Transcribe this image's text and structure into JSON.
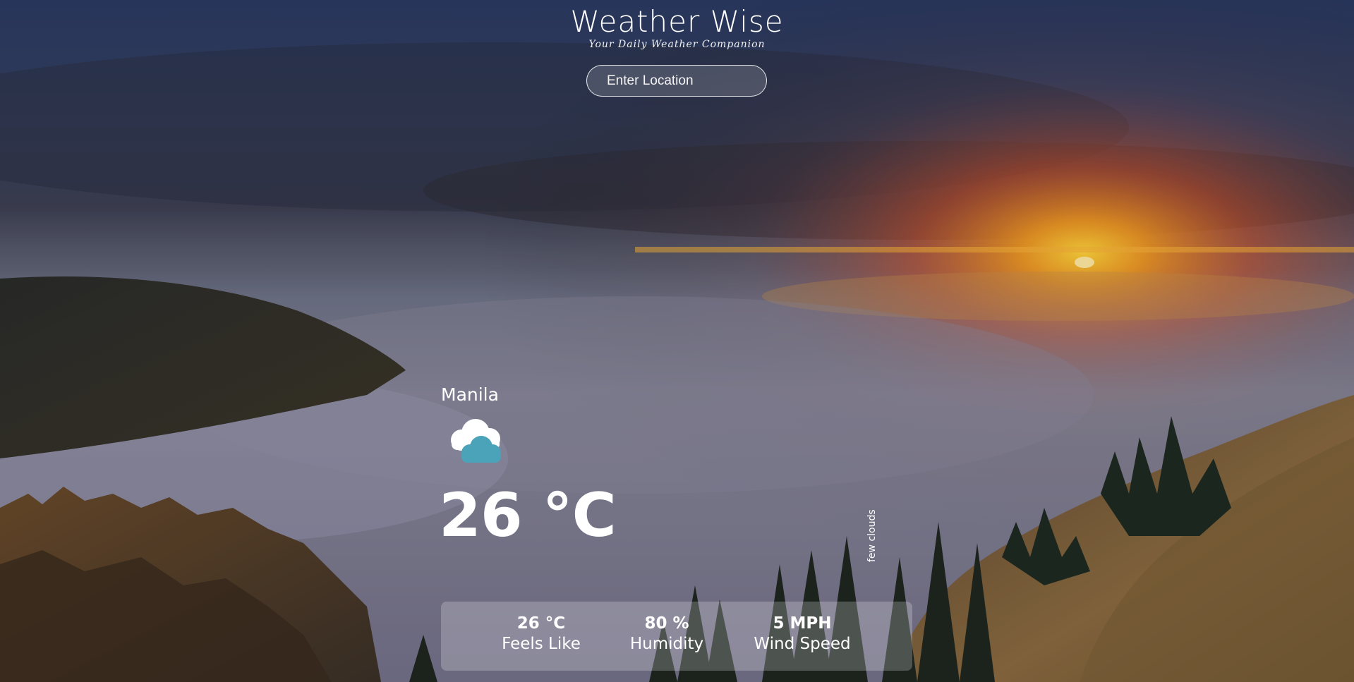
{
  "header": {
    "title": "Weather Wise",
    "subtitle": "Your Daily Weather Companion"
  },
  "search": {
    "placeholder": "Enter Location",
    "value": ""
  },
  "weather": {
    "city": "Manila",
    "icon": "few-clouds-icon",
    "temperature": "26 °C",
    "description": "few clouds"
  },
  "stats": {
    "feels_like": {
      "value": "26 °C",
      "label": "Feels Like"
    },
    "humidity": {
      "value": "80 %",
      "label": "Humidity"
    },
    "wind_speed": {
      "value": "5 MPH",
      "label": "Wind Speed"
    }
  },
  "colors": {
    "text": "#ffffff",
    "icon_cloud_front": "#4aa3b8",
    "icon_cloud_back": "#ffffff",
    "sunset": "#f08a1e"
  }
}
